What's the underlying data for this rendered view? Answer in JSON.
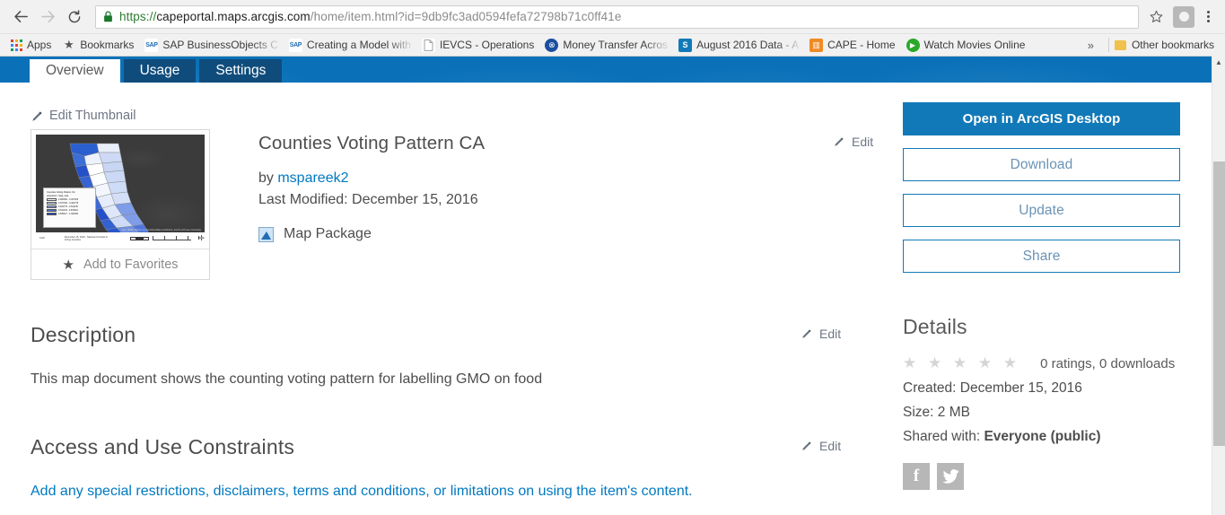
{
  "browser": {
    "back_icon": "back-arrow-icon",
    "forward_icon": "forward-arrow-icon",
    "reload_icon": "reload-icon",
    "url_scheme": "https://",
    "url_host": "capeportal.maps.arcgis.com",
    "url_path": "/home/item.html?id=9db9fc3ad0594fefa72798b71c0ff41e",
    "url_full": "https://capeportal.maps.arcgis.com/home/item.html?id=9db9fc3ad0594fefa72798b71c0ff41e",
    "bookmark_star": "☆",
    "overflow_chevrons": "»"
  },
  "bookmarks": {
    "apps_label": "Apps",
    "items": [
      {
        "label": "Bookmarks",
        "icon": "star-icon"
      },
      {
        "label": "SAP BusinessObjects C",
        "icon": "sap-icon"
      },
      {
        "label": "Creating a Model with",
        "icon": "sap-icon"
      },
      {
        "label": "IEVCS - Operations",
        "icon": "document-icon"
      },
      {
        "label": "Money Transfer Acros",
        "icon": "money-transfer-icon"
      },
      {
        "label": "August 2016 Data - A",
        "icon": "sharepoint-icon"
      },
      {
        "label": "CAPE - Home",
        "icon": "cape-icon"
      },
      {
        "label": "Watch Movies Online",
        "icon": "play-icon"
      }
    ],
    "other_bookmarks": "Other bookmarks"
  },
  "tabs": [
    {
      "label": "Overview",
      "active": true
    },
    {
      "label": "Usage",
      "active": false
    },
    {
      "label": "Settings",
      "active": false
    }
  ],
  "item": {
    "edit_thumbnail_label": "Edit Thumbnail",
    "add_to_favorites_label": "Add to Favorites",
    "favorites_star": "★",
    "title": "Counties Voting Pattern CA",
    "by_prefix": "by ",
    "owner": "mspareek2",
    "last_modified": "Last Modified: December 15, 2016",
    "type_label": "Map Package",
    "edit_label": "Edit"
  },
  "thumbnail_map": {
    "legend_title": "Counties Voting Pattern CA",
    "legend_subtitle": "proportion: total_vote",
    "legend_entries": [
      "0.000000 - 0.337329",
      "0.337330 - 0.462778",
      "0.462779 - 0.541135",
      "0.541136 - 0.635416",
      "0.635417 - 1.000000"
    ],
    "credit": "Esri, HERE, Garmin, (c) OpenStreetMap contributors, and the GIS user community",
    "footer_left": "CA/0",
    "footer_center": "December 15, 2016 - National Counties & Voting Counties",
    "scale_unit": "Miles"
  },
  "sections": [
    {
      "title": "Description",
      "body": "This map document shows the counting voting pattern for labelling GMO on food",
      "edit_label": "Edit",
      "is_link": false
    },
    {
      "title": "Access and Use Constraints",
      "body": "Add any special restrictions, disclaimers, terms and conditions, or limitations on using the item's content.",
      "edit_label": "Edit",
      "is_link": true
    }
  ],
  "actions": {
    "open_in_desktop": "Open in ArcGIS Desktop",
    "download": "Download",
    "update": "Update",
    "share": "Share"
  },
  "details": {
    "heading": "Details",
    "stars": "★ ★ ★ ★ ★",
    "ratings_text": "0 ratings, 0 downloads",
    "created": "Created: December 15, 2016",
    "size": "Size: 2 MB",
    "shared_with_label": "Shared with: ",
    "shared_with_value": "Everyone (public)",
    "social": [
      {
        "name": "facebook-icon",
        "glyph": "f"
      },
      {
        "name": "twitter-icon",
        "glyph": "🐦"
      }
    ]
  },
  "colors": {
    "accent_blue": "#1279b8",
    "banner_blue": "#0a71b8",
    "tab_inactive": "#0f4c7c",
    "link_blue": "#0079c1",
    "text_gray": "#4d4d4d"
  }
}
